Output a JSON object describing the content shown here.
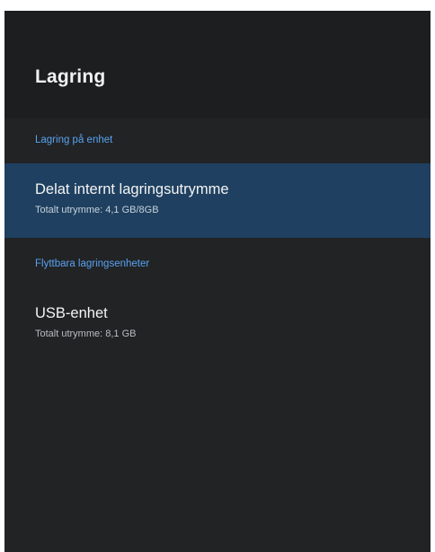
{
  "page": {
    "title": "Lagring"
  },
  "sections": [
    {
      "header": "Lagring på enhet",
      "items": [
        {
          "title": "Delat internt lagringsutrymme",
          "subtitle": "Totalt utrymme: 4,1 GB/8GB",
          "focused": true
        }
      ]
    },
    {
      "header": "Flyttbara lagringsenheter",
      "items": [
        {
          "title": "USB-enhet",
          "subtitle": "Totalt utrymme: 8,1 GB",
          "focused": false
        }
      ]
    }
  ],
  "colors": {
    "background": "#212325",
    "header_background": "#1c1e20",
    "focused_row": "#1f4060",
    "section_header": "#5aa2f0",
    "text": "#f4f4f4",
    "subtext": "#c9ced3"
  }
}
